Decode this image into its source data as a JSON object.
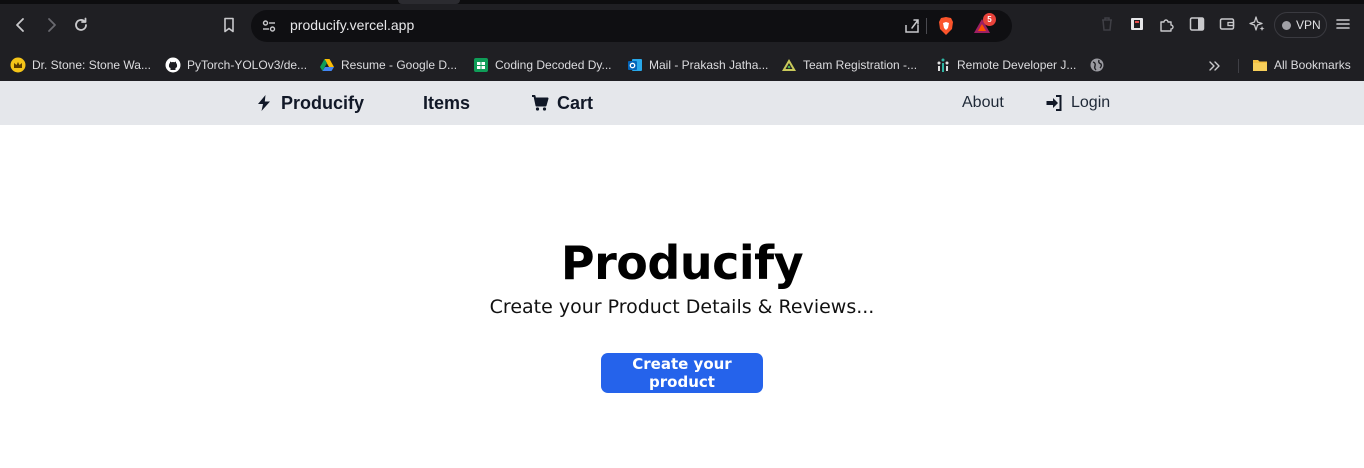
{
  "browser": {
    "url": "producify.vercel.app",
    "extension_badge_count": "5",
    "vpn_label": "VPN",
    "icons": {
      "back": "back-arrow-icon",
      "forward": "forward-arrow-icon",
      "reload": "reload-icon",
      "bookmark": "bookmark-icon",
      "site_settings": "site-settings-icon",
      "share": "share-icon",
      "brave_shields": "brave-shields-icon",
      "rewards": "brave-rewards-icon",
      "extensions": "puzzle-icon",
      "sidebar": "sidebar-icon",
      "wallet": "wallet-icon",
      "leo": "ai-sparkle-icon",
      "menu": "hamburger-menu-icon"
    }
  },
  "bookmarks": {
    "items": [
      {
        "label": "Dr. Stone: Stone Wa...",
        "icon": "crown-icon"
      },
      {
        "label": "PyTorch-YOLOv3/de...",
        "icon": "github-icon"
      },
      {
        "label": "Resume - Google D...",
        "icon": "google-drive-icon"
      },
      {
        "label": "Coding Decoded Dy...",
        "icon": "google-sheets-icon"
      },
      {
        "label": "Mail - Prakash Jatha...",
        "icon": "outlook-icon"
      },
      {
        "label": "Team Registration -...",
        "icon": "triangle-logo-icon"
      },
      {
        "label": "Remote Developer J...",
        "icon": "turing-logo-icon"
      },
      {
        "label": "",
        "icon": "globe-icon"
      }
    ],
    "overflow_icon": "chevron-double-right-icon",
    "all_bookmarks_label": "All Bookmarks"
  },
  "site_nav": {
    "brand": "Producify",
    "items": "Items",
    "cart": "Cart",
    "about": "About",
    "login": "Login"
  },
  "hero": {
    "title": "Producify",
    "subtitle": "Create your Product Details & Reviews...",
    "cta": "Create your product"
  },
  "colors": {
    "browser_chrome": "#1f1f23",
    "nav_background": "#e5e7eb",
    "cta_background": "#2563eb"
  }
}
